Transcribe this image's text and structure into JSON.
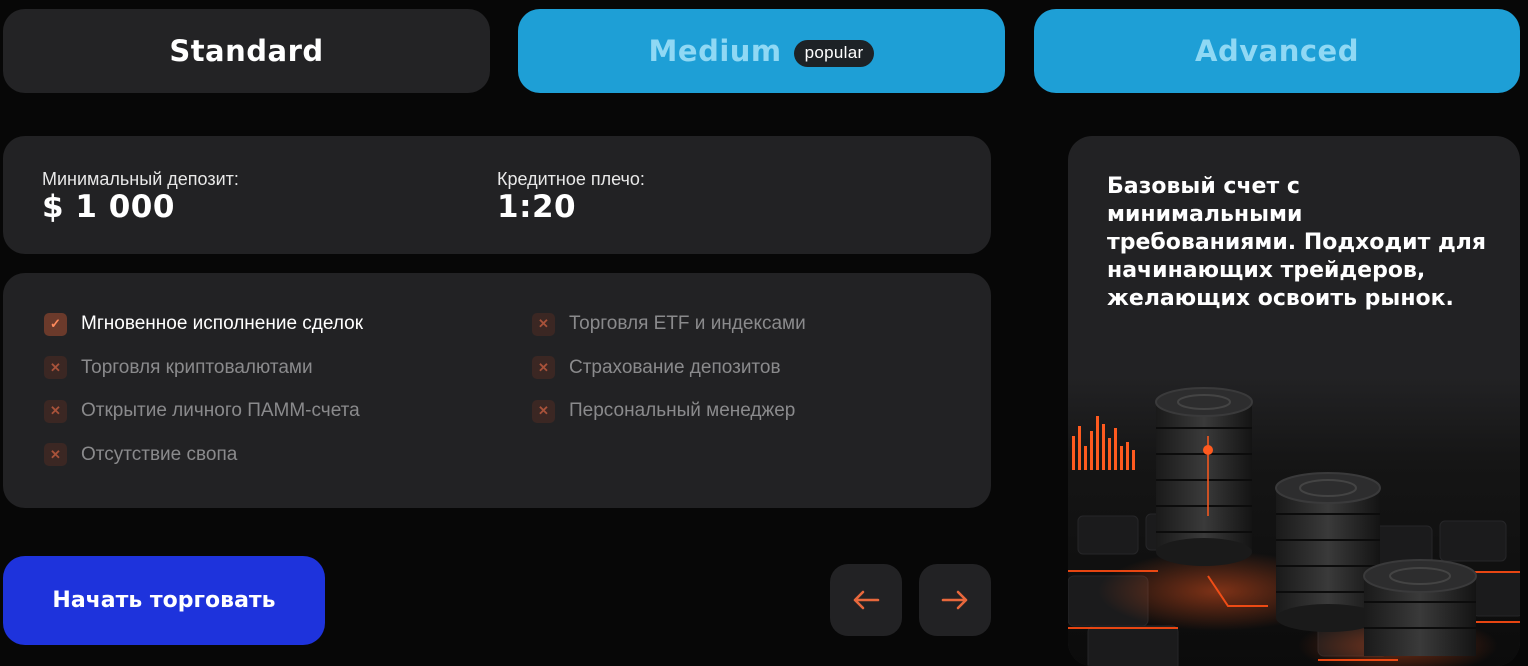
{
  "tabs": [
    {
      "label": "Standard"
    },
    {
      "label": "Medium",
      "badge": "popular"
    },
    {
      "label": "Advanced"
    }
  ],
  "stats": {
    "min_deposit_label": "Минимальный депозит:",
    "min_deposit_value": "$ 1 000",
    "leverage_label": "Кредитное плечо:",
    "leverage_value": "1:20"
  },
  "features": [
    {
      "label": "Мгновенное исполнение сделок",
      "included": true
    },
    {
      "label": "Торговля криптовалютами",
      "included": false
    },
    {
      "label": "Открытие личного ПАММ-счета",
      "included": false
    },
    {
      "label": "Отсутствие свопа",
      "included": false
    },
    {
      "label": "Торговля ETF и индексами",
      "included": false
    },
    {
      "label": "Страхование депозитов",
      "included": false
    },
    {
      "label": "Персональный менеджер",
      "included": false
    }
  ],
  "cta_label": "Начать торговать",
  "nav": {
    "prev_icon": "arrow-left-icon",
    "next_icon": "arrow-right-icon"
  },
  "description": "Базовый счет с минимальными требованиями. Подходит для начинающих трейдеров, желающих освоить рынок.",
  "colors": {
    "accent_blue": "#1e9fd6",
    "cta_blue": "#1e33dc",
    "panel": "#222224",
    "background": "#070707",
    "highlight_orange": "#ff5a1f"
  }
}
